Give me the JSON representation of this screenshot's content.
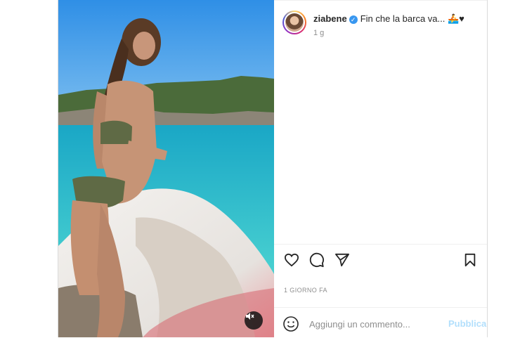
{
  "post": {
    "username": "ziabene",
    "caption_text": "Fin che la barca va...",
    "caption_emoji": "🚣♥",
    "time_short": "1 g",
    "posted_label": "1 GIORNO FA"
  },
  "comment": {
    "placeholder": "Aggiungi un commento...",
    "publish_label": "Pubblica"
  },
  "icons": {
    "verified": "verified-badge-icon",
    "like": "heart-icon",
    "comment": "comment-bubble-icon",
    "share": "paper-plane-icon",
    "save": "bookmark-icon",
    "emoji": "smiley-icon",
    "mute": "speaker-muted-icon"
  },
  "colors": {
    "link_blue": "#3897f0",
    "publish_disabled": "#b2dffc",
    "text": "#262626",
    "muted": "#8e8e8e"
  }
}
